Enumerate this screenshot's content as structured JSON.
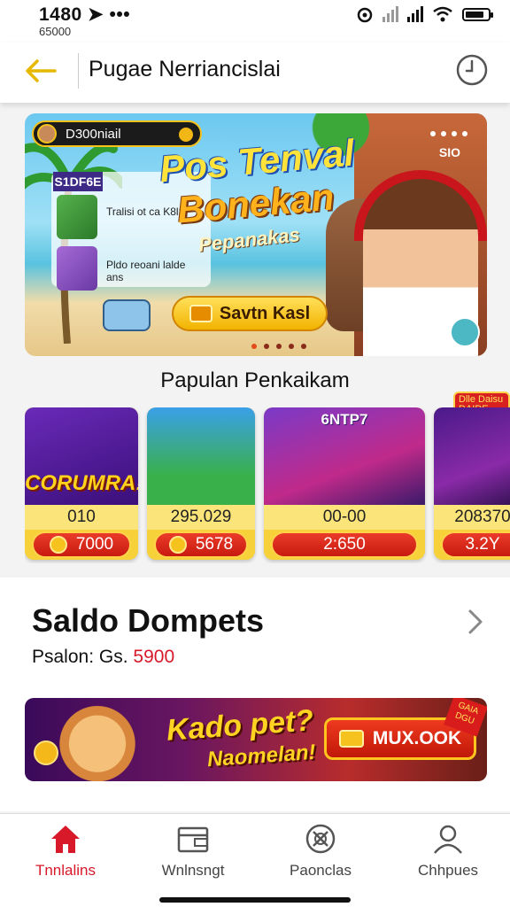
{
  "status_bar": {
    "time": "1480",
    "sub_text": "65000"
  },
  "app_bar": {
    "title": "Pugae Nerriancislai"
  },
  "hero_banner": {
    "player_tag": "D300niail",
    "side_header": "S1DF6E",
    "side_line_1": "Tralisi ot ca K8lS",
    "side_line_2": "Pldo reoani lalde ans",
    "headline_1": "Pos Tenval",
    "headline_2": "Bonekan",
    "headline_3": "Pepanakas",
    "cta_label": "Savtn Kasl",
    "corner_label": "SIO",
    "page_count": 5,
    "active_page": 1
  },
  "popular": {
    "title": "Papulan Penkaikam",
    "badge_text": "Dlle Daisu DAIDE",
    "cards": [
      {
        "art_text": "CORUMRA!",
        "value": "010",
        "button": "7000"
      },
      {
        "art_text": "",
        "value": "295.029",
        "button": "5678"
      },
      {
        "art_text": "6NTP7",
        "value": "00-00",
        "button": "2:650"
      },
      {
        "art_text": "",
        "value": "208370",
        "button": "3.2Y"
      }
    ]
  },
  "wallet": {
    "title": "Saldo Dompets",
    "label": "Psalon: Gs.",
    "amount": "5900"
  },
  "promo": {
    "line_1": "Kado pet?",
    "line_2": "Naomelan!",
    "button": "MUX.OOK",
    "ribbon": "GAIA DGU"
  },
  "bottom_nav": [
    {
      "label": "Tnnlalins",
      "icon": "home-icon",
      "active": true
    },
    {
      "label": "Wnlnsngt",
      "icon": "wallet-icon",
      "active": false
    },
    {
      "label": "Paonclas",
      "icon": "games-icon",
      "active": false
    },
    {
      "label": "Chhpues",
      "icon": "profile-icon",
      "active": false
    }
  ],
  "colors": {
    "accent_red": "#d7192a",
    "accent_yellow": "#f4c21a",
    "back_arrow": "#e6b800"
  }
}
